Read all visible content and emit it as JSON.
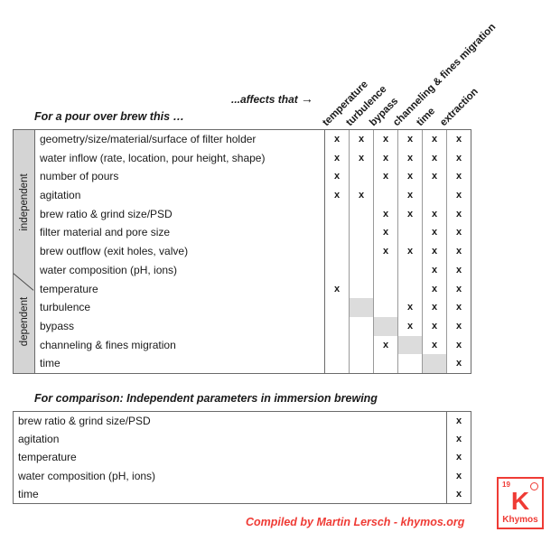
{
  "headings": {
    "affects_label": "...affects that",
    "affects_arrow": "→",
    "main_caption": "For a pour over brew this …",
    "compare_caption": "For comparison: Independent parameters in immersion brewing"
  },
  "columns": [
    "temperature",
    "turbulence",
    "bypass",
    "channeling & fines migration",
    "time",
    "extraction"
  ],
  "bands": {
    "independent": "independent",
    "dependent": "dependent"
  },
  "mark": "x",
  "matrix": {
    "rows": [
      {
        "label": "geometry/size/material/surface of filter holder",
        "band": "independent",
        "cells": [
          "x",
          "x",
          "x",
          "x",
          "x",
          "x"
        ]
      },
      {
        "label": "water inflow (rate, location, pour height, shape)",
        "band": "independent",
        "cells": [
          "x",
          "x",
          "x",
          "x",
          "x",
          "x"
        ]
      },
      {
        "label": "number of pours",
        "band": "independent",
        "cells": [
          "x",
          "",
          "x",
          "x",
          "x",
          "x"
        ]
      },
      {
        "label": "agitation",
        "band": "independent",
        "cells": [
          "x",
          "x",
          "",
          "x",
          "",
          "x"
        ]
      },
      {
        "label": "brew ratio & grind size/PSD",
        "band": "independent",
        "cells": [
          "",
          "",
          "x",
          "x",
          "x",
          "x"
        ]
      },
      {
        "label": "filter material and pore size",
        "band": "independent",
        "cells": [
          "",
          "",
          "x",
          "",
          "x",
          "x"
        ]
      },
      {
        "label": "brew outflow (exit holes, valve)",
        "band": "independent",
        "cells": [
          "",
          "",
          "x",
          "x",
          "x",
          "x"
        ]
      },
      {
        "label": "water composition (pH, ions)",
        "band": "independent",
        "cells": [
          "",
          "",
          "",
          "",
          "x",
          "x"
        ]
      },
      {
        "label": "temperature",
        "band": "dependent",
        "cells": [
          "x",
          "",
          "",
          "",
          "x",
          "x"
        ]
      },
      {
        "label": "turbulence",
        "band": "dependent",
        "cells": [
          "",
          "gray",
          "",
          "x",
          "x",
          "x"
        ]
      },
      {
        "label": "bypass",
        "band": "dependent",
        "cells": [
          "",
          "",
          "gray",
          "x",
          "x",
          "x"
        ]
      },
      {
        "label": "channeling & fines migration",
        "band": "dependent",
        "cells": [
          "",
          "",
          "x",
          "gray",
          "x",
          "x"
        ]
      },
      {
        "label": "time",
        "band": "dependent",
        "cells": [
          "",
          "",
          "",
          "",
          "gray",
          "x"
        ]
      }
    ]
  },
  "comparison": {
    "rows": [
      {
        "label": "brew ratio & grind size/PSD",
        "mark": "x"
      },
      {
        "label": "agitation",
        "mark": "x"
      },
      {
        "label": "temperature",
        "mark": "x"
      },
      {
        "label": "water composition (pH, ions)",
        "mark": "x"
      },
      {
        "label": "time",
        "mark": "x"
      }
    ]
  },
  "credit": "Compiled by Martin Lersch - khymos.org",
  "logo": {
    "number": "19",
    "symbol": "K",
    "name": "Khymos"
  },
  "colors": {
    "brand_red": "#ef3b35",
    "band_gray": "#d4d4d4",
    "cell_gray": "#dcdcdc",
    "border": "#6a6a6a"
  }
}
